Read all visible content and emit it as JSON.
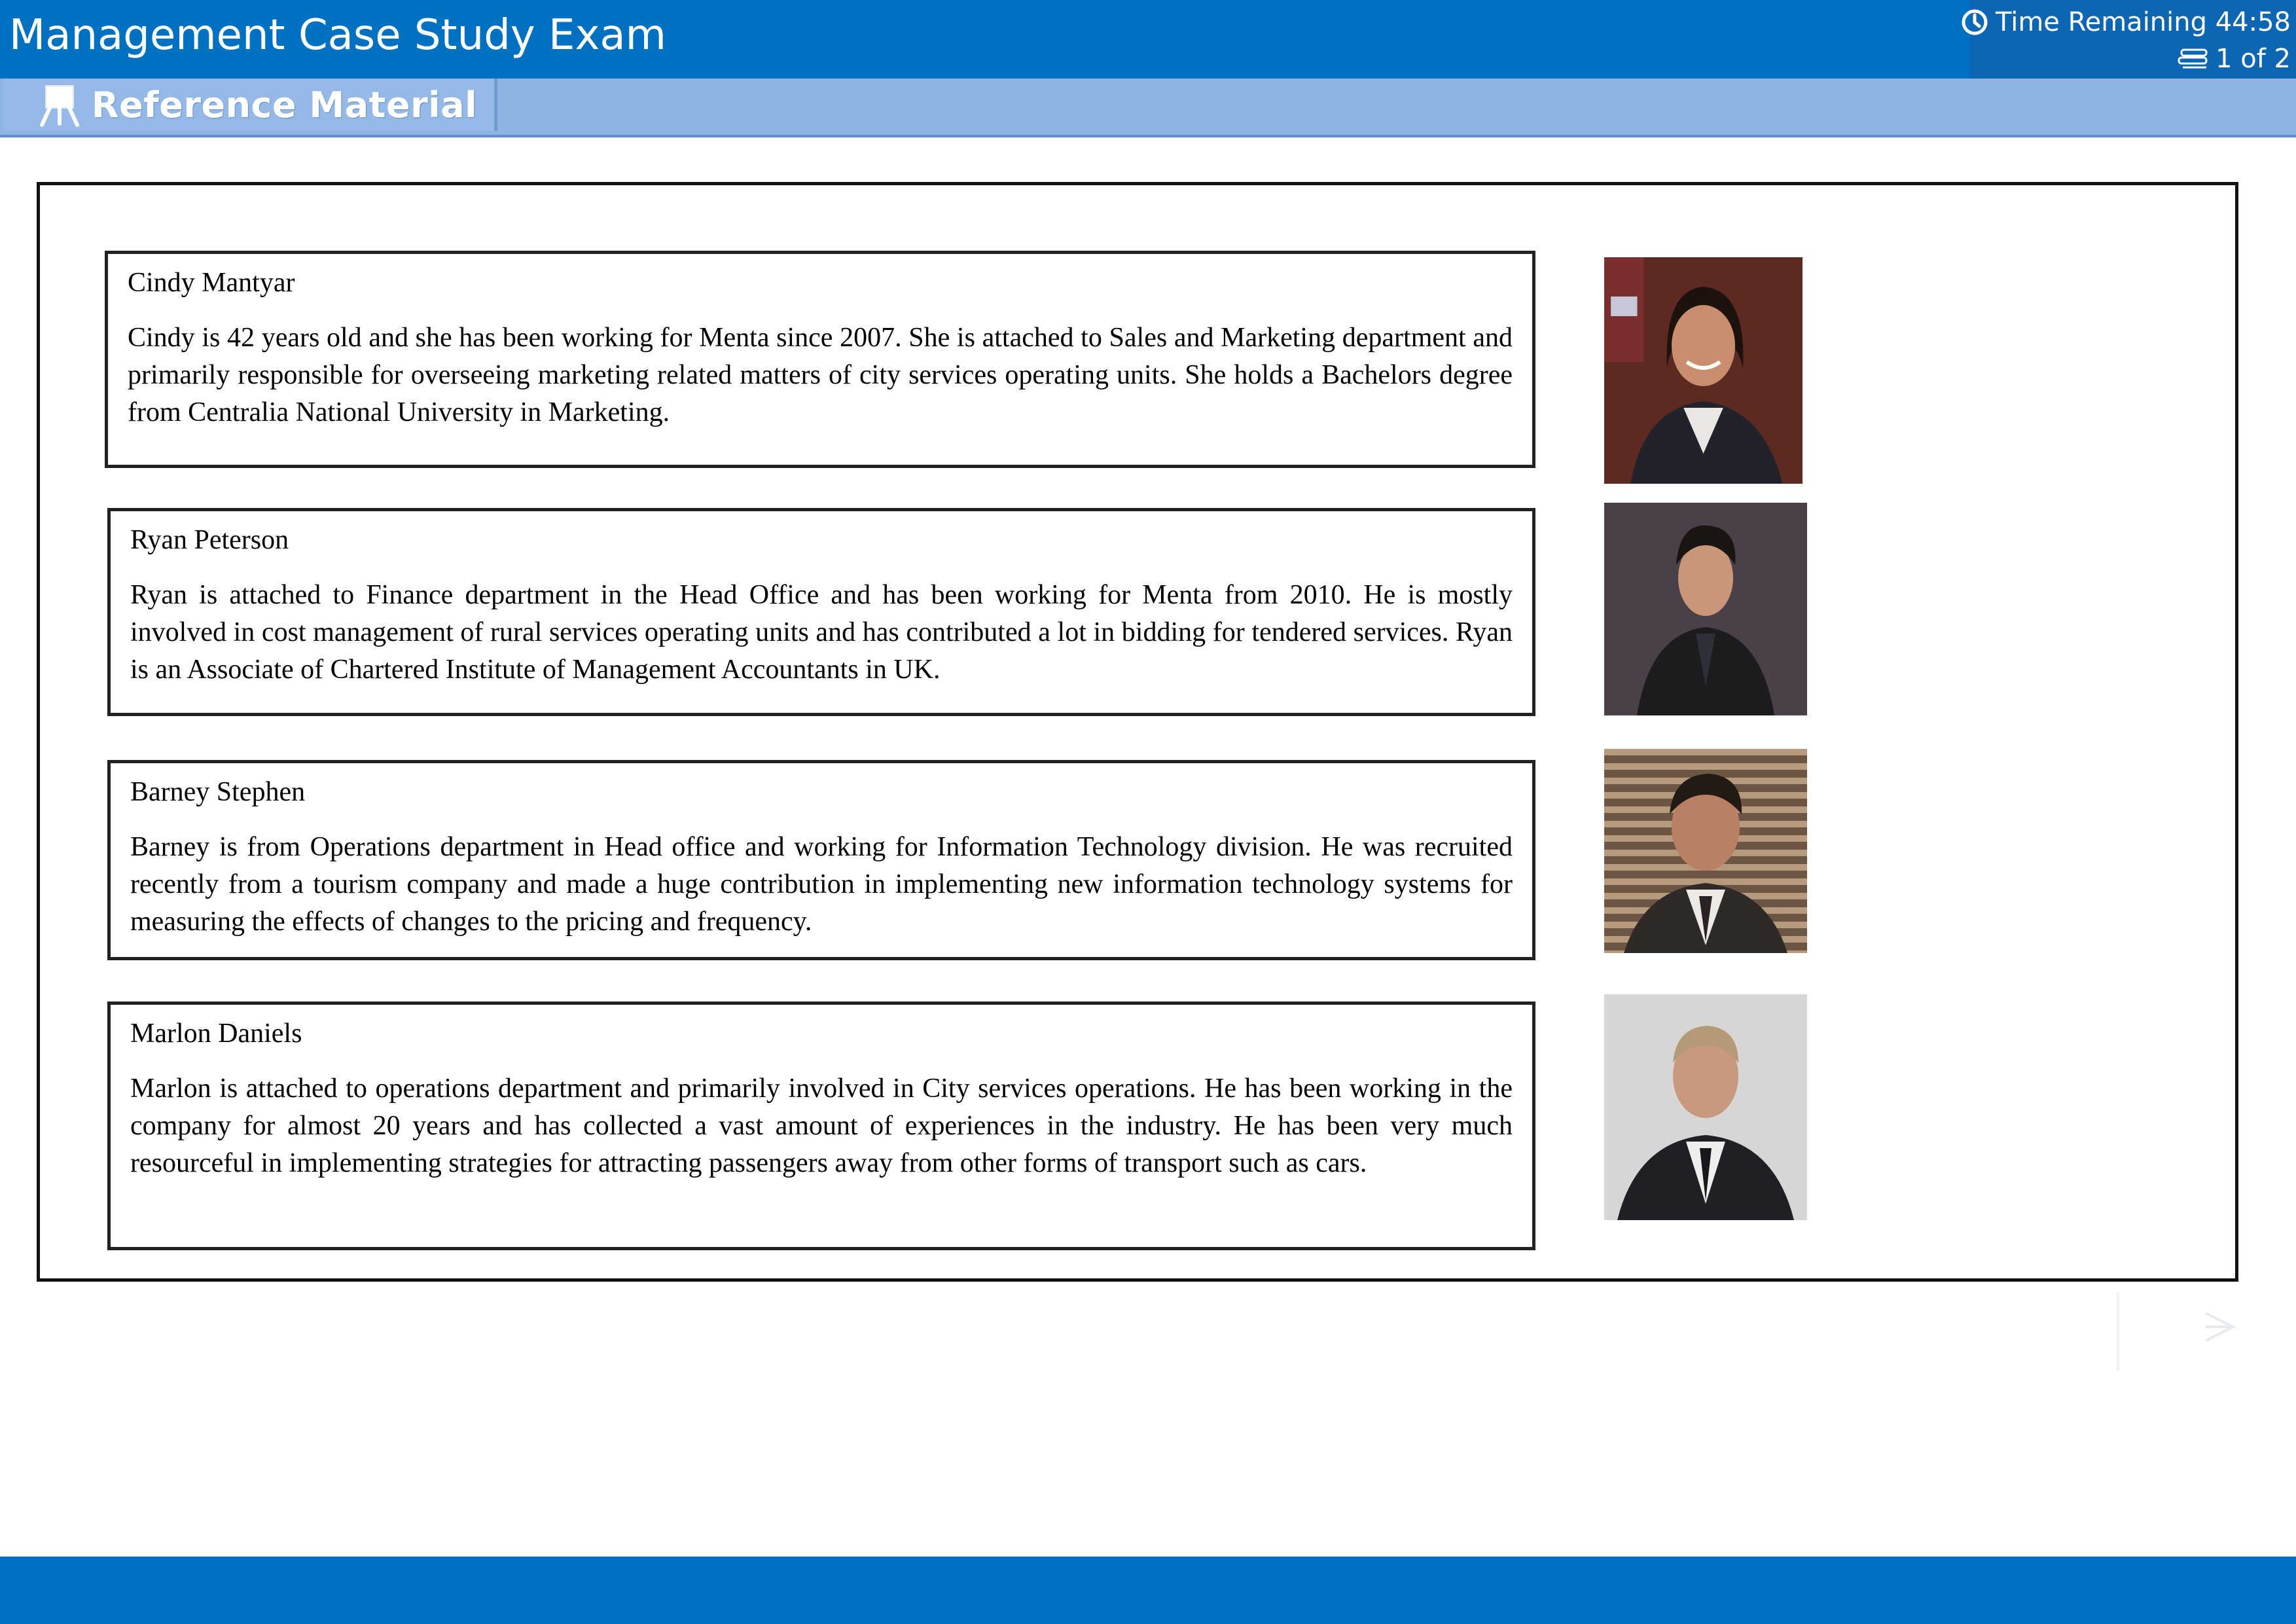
{
  "header": {
    "title": "Management Case Study Exam",
    "time_remaining": "Time Remaining 44:58",
    "page_indicator": "1 of 2",
    "colors": {
      "header_bg": "#0070c0",
      "toolbar_bg": "#8db3e2"
    }
  },
  "toolbar": {
    "reference_tab_label": "Reference Material",
    "reference_tab_icon": "easel-icon"
  },
  "profiles": [
    {
      "name": "Cindy Mantyar",
      "bio": "Cindy is 42 years old and she has been working for Menta since 2007. She is attached to Sales and Marketing department and primarily responsible for overseeing marketing related matters of city services operating units. She holds a Bachelors degree from Centralia National University in Marketing."
    },
    {
      "name": "Ryan Peterson",
      "bio": "Ryan is attached to Finance department in the Head Office and has been working for Menta from 2010. He is mostly involved in cost management of rural services operating units and has contributed a lot in bidding for tendered services. Ryan is an Associate of Chartered Institute of Management Accountants in UK."
    },
    {
      "name": "Barney Stephen",
      "bio": "Barney is from Operations department in Head office and working for Information Technology division. He was recruited recently from a tourism company and made a huge contribution in implementing new information technology systems for measuring the effects of changes to the pricing and frequency."
    },
    {
      "name": "Marlon Daniels",
      "bio": "Marlon is attached to operations department and primarily involved in City services operations. He has been working in the company for almost 20 years and has collected a vast amount of experiences in the industry. He has been very much resourceful in implementing strategies for attracting passengers away from other forms of transport such as cars."
    }
  ],
  "navigation": {
    "next_icon": "chevron-right-icon"
  }
}
